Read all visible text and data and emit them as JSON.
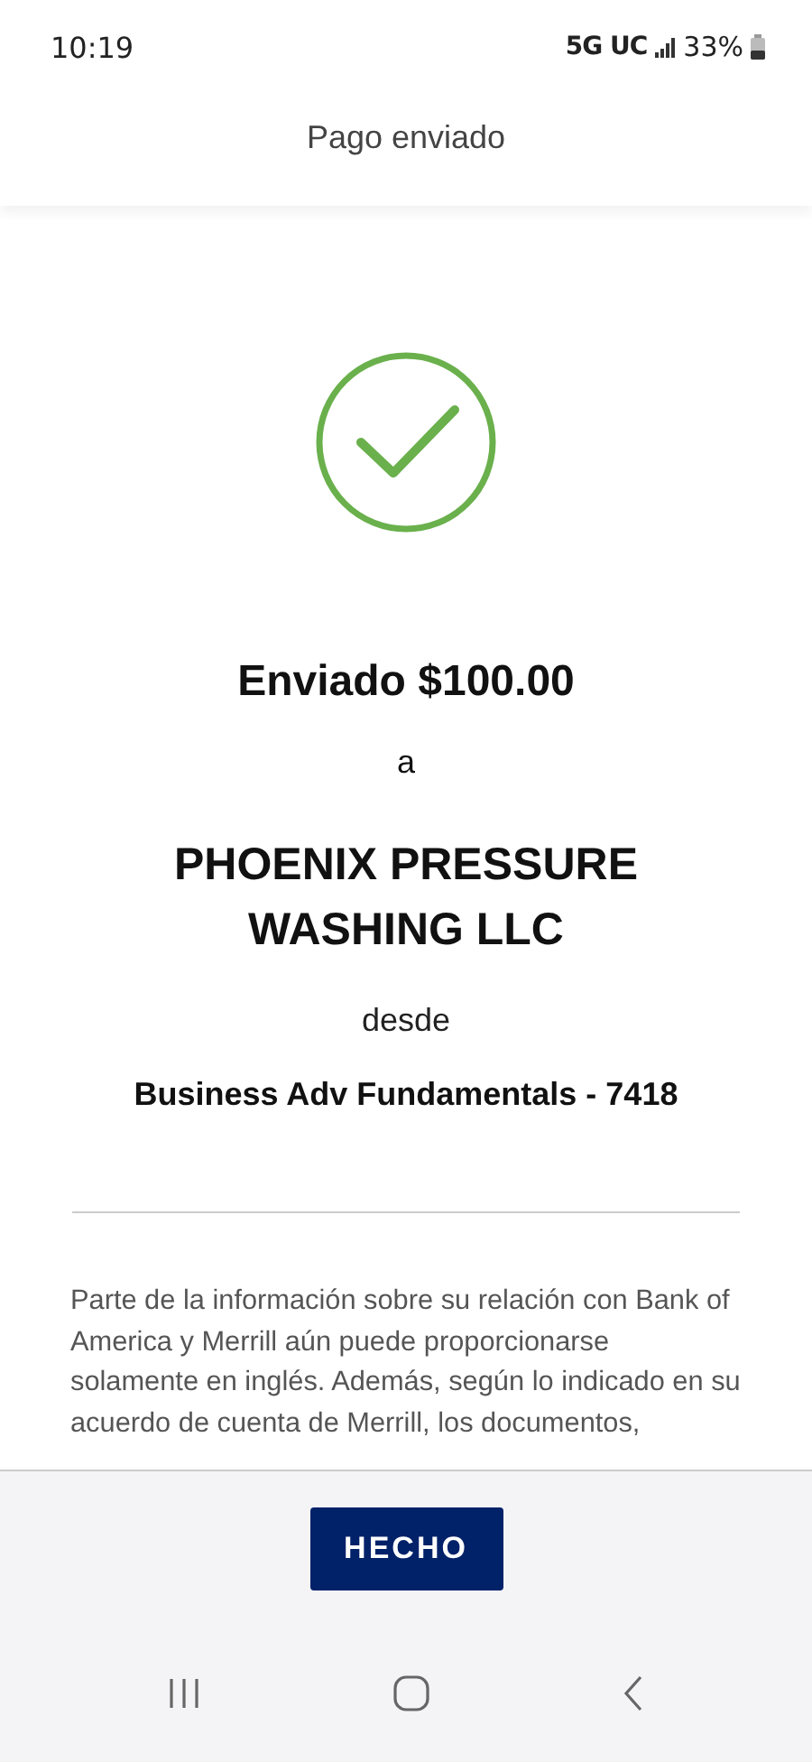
{
  "status_bar": {
    "time": "10:19",
    "network": "5G UC",
    "battery": "33%"
  },
  "header": {
    "title": "Pago enviado"
  },
  "confirmation": {
    "succeeded": true,
    "headline": "Enviado $100.00",
    "connector": "a",
    "recipient": "PHOENIX PRESSURE WASHING LLC",
    "from_label": "desde",
    "account": "Business Adv Fundamentals - 7418"
  },
  "disclaimer": "Parte de la información sobre su relación con Bank of America y Merrill aún puede proporcionarse solamente en inglés. Además, según lo indicado en su acuerdo de cuenta de Merrill, los documentos,",
  "footer": {
    "button": "HECHO"
  }
}
